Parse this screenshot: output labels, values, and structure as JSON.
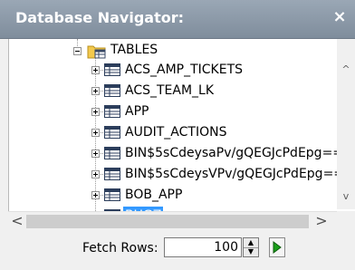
{
  "header": {
    "title": "Database Navigator:",
    "close_glyph": "×"
  },
  "tree": {
    "folder": {
      "label": "TABLES",
      "icon": "folder-table-icon",
      "expanded": true
    },
    "items": [
      {
        "label": "ACS_AMP_TICKETS",
        "icon": "table-icon"
      },
      {
        "label": "ACS_TEAM_LK",
        "icon": "table-icon"
      },
      {
        "label": "APP",
        "icon": "table-icon"
      },
      {
        "label": "AUDIT_ACTIONS",
        "icon": "table-icon"
      },
      {
        "label": "BIN$5sCdeysaPv/gQEGJcPdEpg==",
        "icon": "table-icon"
      },
      {
        "label": "BIN$5sCdeysVPv/gQEGJcPdEpg==",
        "icon": "table-icon"
      },
      {
        "label": "BOB_APP",
        "icon": "table-icon"
      },
      {
        "label": "BUGZ",
        "icon": "table-icon",
        "selected": true
      }
    ]
  },
  "scrollbars": {
    "up_glyph": "^",
    "down_glyph": "v",
    "left_glyph": "<",
    "right_glyph": ">"
  },
  "footer": {
    "fetch_label": "Fetch Rows:",
    "fetch_value": "100",
    "go_icon": "play-icon",
    "colors": {
      "play": "#1a9e1a"
    }
  }
}
